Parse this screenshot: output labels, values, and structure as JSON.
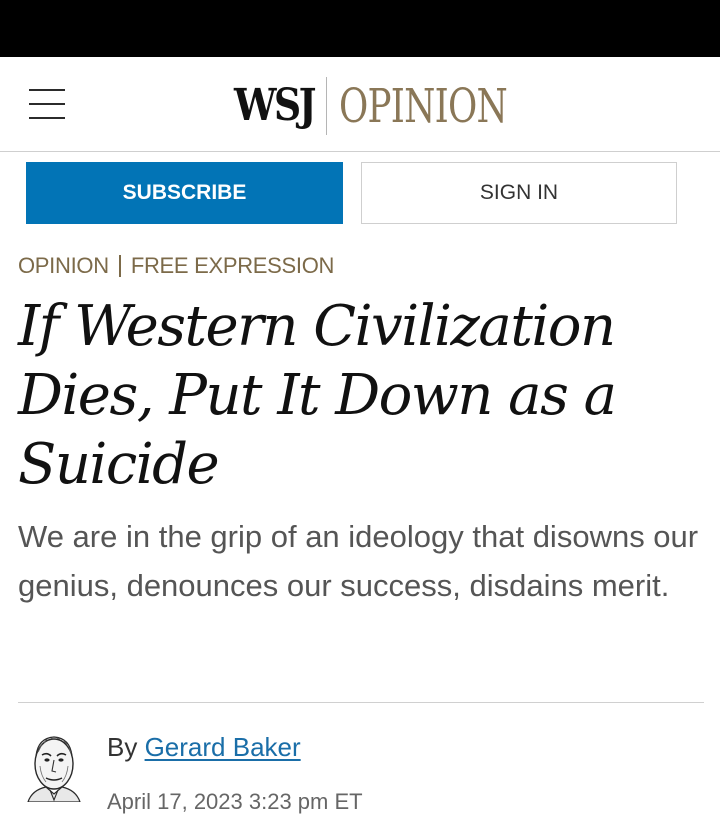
{
  "header": {
    "menu_icon": "hamburger-menu-icon",
    "brand": {
      "wsj": "WSJ",
      "section": "OPINION"
    }
  },
  "actions": {
    "subscribe_label": "SUBSCRIBE",
    "signin_label": "SIGN IN"
  },
  "article": {
    "section": "OPINION",
    "subsection": "FREE EXPRESSION",
    "headline": "If Western Civilization Dies, Put It Down as a Suicide",
    "dek": "We are in the grip of an ideology that disowns our genius, denounces our success, disdains merit.",
    "byline_prefix": "By",
    "author": "Gerard Baker",
    "timestamp": "April 17, 2023 3:23 pm ET"
  },
  "colors": {
    "accent_blue": "#0274b6",
    "opinion_tan": "#8a7757",
    "section_tan": "#7c6a49",
    "link_blue": "#1a6ea8"
  }
}
